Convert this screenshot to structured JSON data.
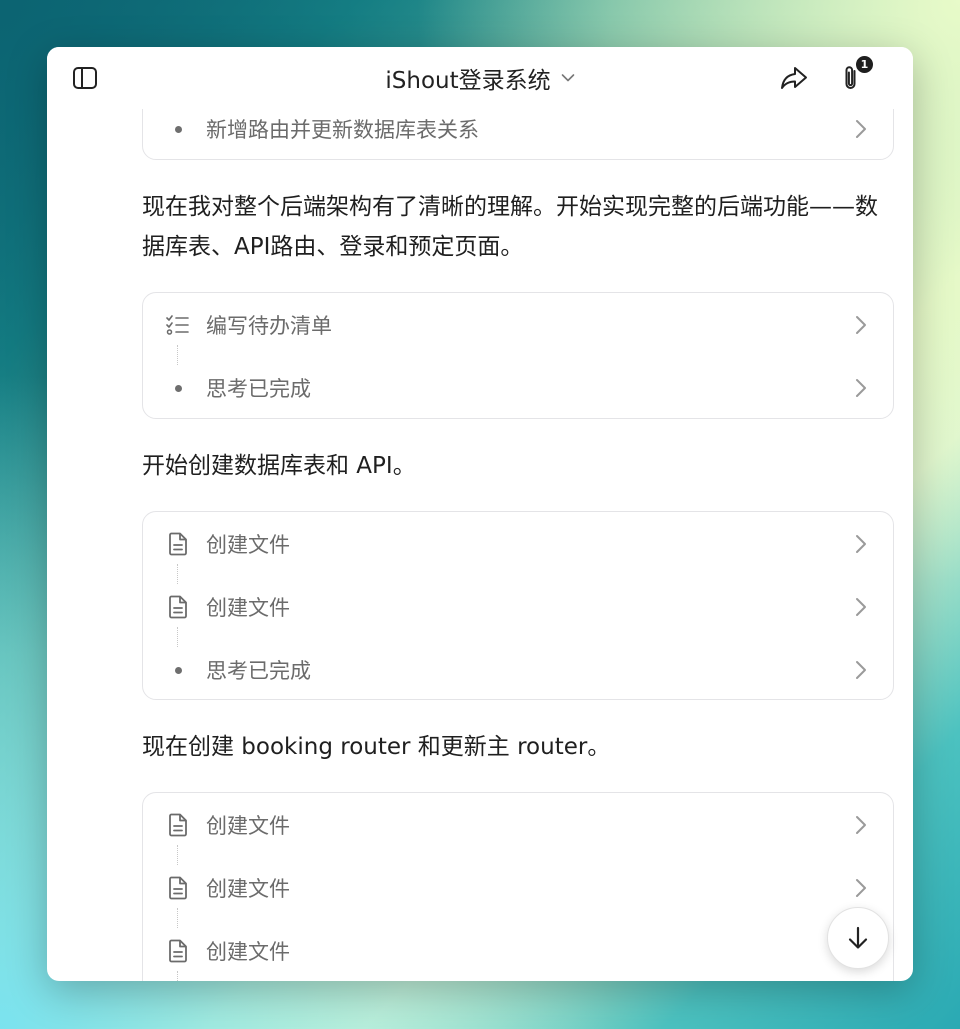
{
  "header": {
    "title": "iShout登录系统",
    "attachment_count": "1"
  },
  "blocks": {
    "card0": {
      "rows": [
        {
          "label": "新增路由并更新数据库表关系",
          "icon": "dot-icon"
        }
      ]
    },
    "para1": "现在我对整个后端架构有了清晰的理解。开始实现完整的后端功能——数据库表、API路由、登录和预定页面。",
    "card1": {
      "rows": [
        {
          "label": "编写待办清单",
          "icon": "checklist-icon"
        },
        {
          "label": "思考已完成",
          "icon": "dot-icon"
        }
      ]
    },
    "para2": "开始创建数据库表和 API。",
    "card2": {
      "rows": [
        {
          "label": "创建文件",
          "icon": "file-icon"
        },
        {
          "label": "创建文件",
          "icon": "file-icon"
        },
        {
          "label": "思考已完成",
          "icon": "dot-icon"
        }
      ]
    },
    "para3": "现在创建 booking router 和更新主 router。",
    "card3": {
      "rows": [
        {
          "label": "创建文件",
          "icon": "file-icon"
        },
        {
          "label": "创建文件",
          "icon": "file-icon"
        },
        {
          "label": "创建文件",
          "icon": "file-icon"
        }
      ]
    }
  },
  "colors": {
    "text": "#1f1f1f",
    "muted": "#6b6b6b",
    "border": "#e4e4e7"
  }
}
